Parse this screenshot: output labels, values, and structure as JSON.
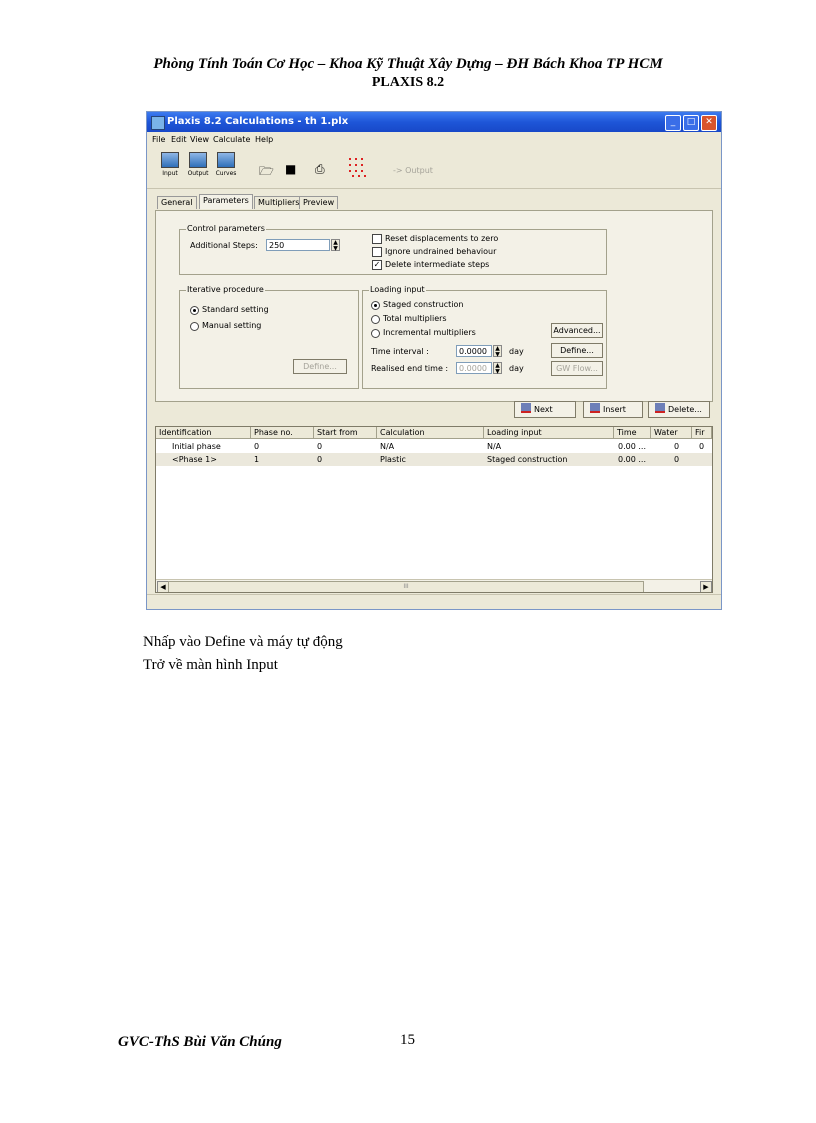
{
  "page": {
    "header_line1": "Phòng Tính Toán Cơ Học – Khoa Kỹ Thuật Xây Dựng – ĐH Bách Khoa TP HCM",
    "header_line2": "PLAXIS 8.2",
    "body_lines": [
      "Nhấp vào Define và máy tự động",
      "Trở về màn hình Input"
    ],
    "footer_author": "GVC-ThS Bùi Văn Chúng",
    "page_number": "15"
  },
  "window": {
    "title": "Plaxis 8.2 Calculations - th 1.plx",
    "menu": [
      "File",
      "Edit",
      "View",
      "Calculate",
      "Help"
    ],
    "toolbar": {
      "input": "Input",
      "output": "Output",
      "curves": "Curves",
      "output_button": "-> Output",
      "icons": [
        "input-icon",
        "output-icon",
        "curves-icon",
        "open-folder-icon",
        "save-disk-icon",
        "print-icon",
        "points-grid-icon"
      ]
    },
    "tabs": [
      "General",
      "Parameters",
      "Multipliers",
      "Preview"
    ],
    "active_tab": "Parameters",
    "control": {
      "caption": "Control parameters",
      "additional_steps_label": "Additional Steps:",
      "additional_steps": "250",
      "reset_label": "Reset displacements to zero",
      "reset_checked": false,
      "ignore_label": "Ignore undrained behaviour",
      "ignore_checked": false,
      "delete_label": "Delete intermediate steps",
      "delete_checked": true
    },
    "iterative": {
      "caption": "Iterative procedure",
      "standard": "Standard setting",
      "manual": "Manual setting",
      "define": "Define..."
    },
    "loading": {
      "caption": "Loading input",
      "staged": "Staged construction",
      "total": "Total multipliers",
      "incremental": "Incremental multipliers",
      "time_interval_label": "Time interval :",
      "time_interval": "0.0000",
      "realised_label": "Realised end time :",
      "realised": "0.0000",
      "unit": "day",
      "advanced": "Advanced...",
      "define": "Define...",
      "gw_flow": "GW Flow..."
    },
    "actions": {
      "next": "Next",
      "insert": "Insert",
      "delete": "Delete..."
    },
    "table": {
      "headers": [
        "Identification",
        "Phase no.",
        "Start from",
        "Calculation",
        "Loading input",
        "Time",
        "Water",
        "Fir"
      ],
      "rows": [
        [
          "Initial phase",
          "0",
          "0",
          "N/A",
          "N/A",
          "0.00 ...",
          "0",
          "0"
        ],
        [
          "<Phase 1>",
          "1",
          "0",
          "Plastic",
          "Staged construction",
          "0.00 ...",
          "0",
          ""
        ]
      ]
    },
    "scroll_thumb": "III"
  }
}
